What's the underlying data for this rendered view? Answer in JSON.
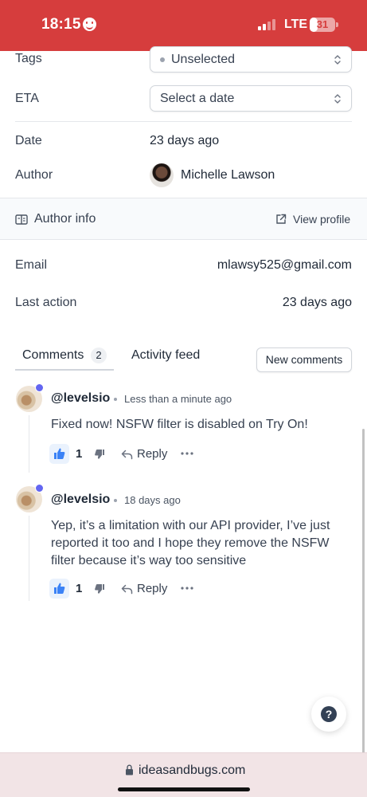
{
  "status_bar": {
    "time": "18:15",
    "network": "LTE",
    "battery": "31",
    "battery_level": 0.31
  },
  "details": {
    "tags_label": "Tags",
    "tags_value": "Unselected",
    "eta_label": "ETA",
    "eta_placeholder": "Select a date",
    "date_label": "Date",
    "date_value": "23 days ago",
    "author_label": "Author",
    "author_name": "Michelle Lawson"
  },
  "author_info": {
    "title": "Author info",
    "view_profile": "View profile",
    "email_label": "Email",
    "email_value": "mlawsy525@gmail.com",
    "last_action_label": "Last action",
    "last_action_value": "23 days ago"
  },
  "tabs": {
    "comments_label": "Comments",
    "comments_count": "2",
    "activity_label": "Activity feed",
    "new_comments_button": "New comments"
  },
  "comments": [
    {
      "author": "@levelsio",
      "time": "Less than a minute ago",
      "body": "Fixed now! NSFW filter is disabled on Try On!",
      "likes": "1",
      "reply_label": "Reply"
    },
    {
      "author": "@levelsio",
      "time": "18 days ago",
      "body": "Yep, it’s a limitation with our API provider, I’ve just reported it too and I hope they remove the NSFW filter because it’s way too sensitive",
      "likes": "1",
      "reply_label": "Reply"
    }
  ],
  "help": {
    "label": "?"
  },
  "browser": {
    "url": "ideasandbugs.com"
  },
  "colors": {
    "status_bar_bg": "#d63d3d",
    "accent": "#6366f1",
    "like_blue": "#3b82f6",
    "url_bar_bg": "#f2e4e6"
  },
  "icons": [
    "smiley-icon",
    "signal-icon",
    "battery-icon",
    "chevron-updown-icon",
    "book-icon",
    "external-link-icon",
    "verified-icon",
    "thumbs-up-icon",
    "thumbs-down-icon",
    "reply-icon",
    "more-icon",
    "help-icon",
    "lock-icon"
  ]
}
